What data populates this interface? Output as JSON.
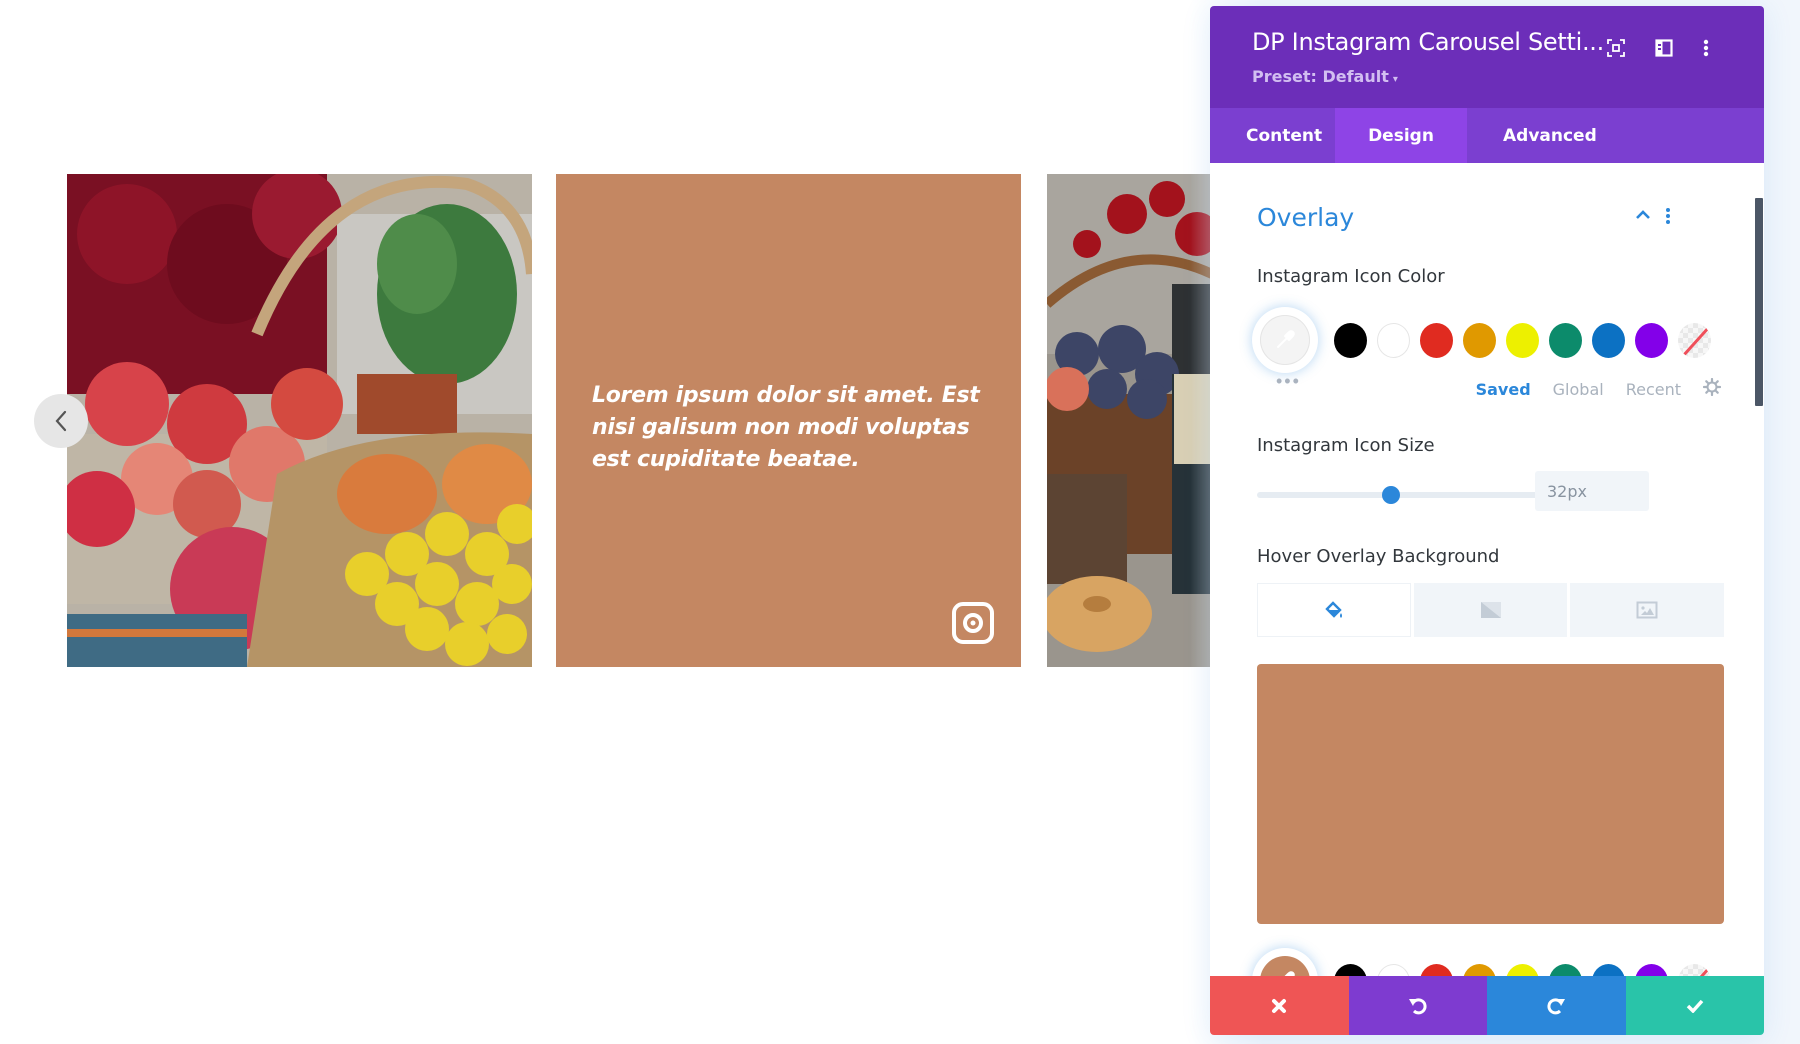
{
  "carousel": {
    "prev_arrow_label": "Previous",
    "overlay_caption": "Lorem ipsum dolor sit amet. Est nisi galisum non modi voluptas est cupiditate beatae.",
    "overlay_color": "#c48762",
    "slides": [
      {
        "alt": "Basket of apples, pomegranate and yellow chrysanthemums"
      },
      {
        "alt": "Hovered slide overlay"
      },
      {
        "alt": "Picnic basket with plums, bottle and cake"
      }
    ]
  },
  "panel": {
    "title": "DP Instagram Carousel Setti...",
    "preset": "Preset: Default",
    "header_icons": [
      "fullscreen-icon",
      "split-view-icon",
      "more-options-icon"
    ],
    "tabs": [
      {
        "label": "Content",
        "active": false
      },
      {
        "label": "Design",
        "active": true
      },
      {
        "label": "Advanced",
        "active": false
      }
    ],
    "section": {
      "title": "Overlay",
      "expanded": true
    },
    "icon_color": {
      "label": "Instagram Icon Color",
      "value": "#ffffff",
      "swatches": [
        "#000000",
        "#ffffff",
        "#e02b20",
        "#e09900",
        "#edf000",
        "#0c8b6b",
        "#0c71c3",
        "#8300e9",
        "none"
      ],
      "palette_tabs": [
        {
          "label": "Saved",
          "active": true
        },
        {
          "label": "Global",
          "active": false
        },
        {
          "label": "Recent",
          "active": false
        }
      ]
    },
    "icon_size": {
      "label": "Instagram Icon Size",
      "value": "32px",
      "slider_fraction": 0.45
    },
    "hover_bg": {
      "label": "Hover Overlay Background",
      "types": [
        {
          "name": "color",
          "active": true
        },
        {
          "name": "gradient",
          "active": false
        },
        {
          "name": "image",
          "active": false
        }
      ],
      "color": "#c48762",
      "swatches": [
        "#000000",
        "#ffffff",
        "#e02b20",
        "#e09900",
        "#edf000",
        "#0c8b6b",
        "#0c71c3",
        "#8300e9",
        "none"
      ]
    },
    "footer": {
      "discard_color": "#ef5555",
      "undo_color": "#7e3bd0",
      "redo_color": "#2b87da",
      "save_color": "#29c4a9"
    }
  }
}
